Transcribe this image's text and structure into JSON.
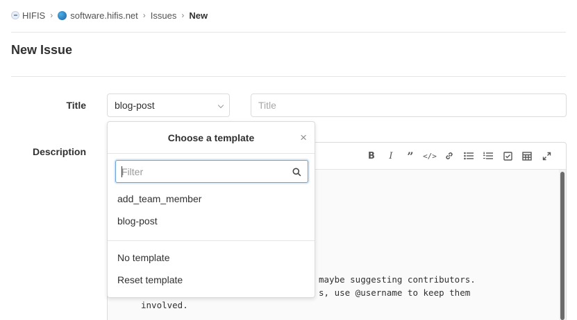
{
  "breadcrumb": {
    "org": "HIFIS",
    "project": "software.hifis.net",
    "section": "Issues",
    "current": "New"
  },
  "page": {
    "title": "New Issue"
  },
  "form": {
    "title_label": "Title",
    "description_label": "Description",
    "template_select_value": "blog-post",
    "title_placeholder": "Title"
  },
  "template_dropdown": {
    "header": "Choose a template",
    "close_symbol": "×",
    "filter_placeholder": "Filter",
    "templates": [
      "add_team_member",
      "blog-post"
    ],
    "actions": [
      "No template",
      "Reset template"
    ]
  },
  "editor": {
    "toolbar_icons": [
      "bold-icon",
      "italic-icon",
      "quote-icon",
      "code-icon",
      "link-icon",
      "bullet-list-icon",
      "numbered-list-icon",
      "task-list-icon",
      "table-icon",
      "fullscreen-icon"
    ],
    "lines": [
      "maybe suggesting contributors.",
      "s, use @username to keep them",
      "involved."
    ]
  },
  "colors": {
    "focus_border": "#6a9fd6",
    "border": "#dbdbdb",
    "text": "#303030"
  }
}
